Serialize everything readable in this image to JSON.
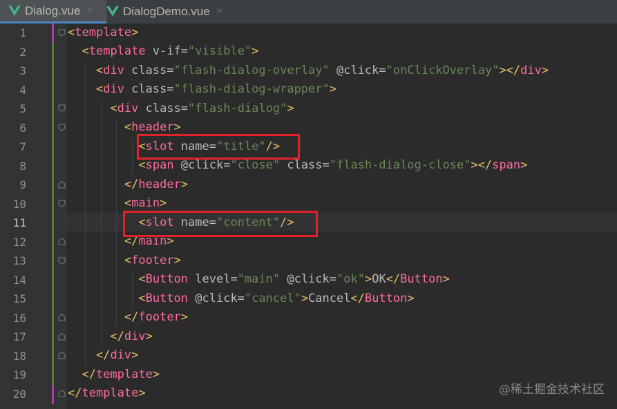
{
  "tabs": [
    {
      "label": "Dialog.vue",
      "close": "×",
      "active": true
    },
    {
      "label": "DialogDemo.vue",
      "close": "×",
      "active": false
    }
  ],
  "line_numbers": [
    "1",
    "2",
    "3",
    "4",
    "5",
    "6",
    "7",
    "8",
    "9",
    "10",
    "11",
    "12",
    "13",
    "14",
    "15",
    "16",
    "17",
    "18",
    "19",
    "20"
  ],
  "current_line": "11",
  "code_lines": [
    {
      "num": "1",
      "text": "<template>"
    },
    {
      "num": "2",
      "text": "  <template v-if=\"visible\">"
    },
    {
      "num": "3",
      "text": "    <div class=\"flash-dialog-overlay\" @click=\"onClickOverlay\"></div>"
    },
    {
      "num": "4",
      "text": "    <div class=\"flash-dialog-wrapper\">"
    },
    {
      "num": "5",
      "text": "      <div class=\"flash-dialog\">"
    },
    {
      "num": "6",
      "text": "        <header>"
    },
    {
      "num": "7",
      "text": "          <slot name=\"title\"/>"
    },
    {
      "num": "8",
      "text": "          <span @click=\"close\" class=\"flash-dialog-close\"></span>"
    },
    {
      "num": "9",
      "text": "        </header>"
    },
    {
      "num": "10",
      "text": "        <main>"
    },
    {
      "num": "11",
      "text": "          <slot name=\"content\"/>"
    },
    {
      "num": "12",
      "text": "        </main>"
    },
    {
      "num": "13",
      "text": "        <footer>"
    },
    {
      "num": "14",
      "text": "          <Button level=\"main\" @click=\"ok\">OK</Button>"
    },
    {
      "num": "15",
      "text": "          <Button @click=\"cancel\">Cancel</Button>"
    },
    {
      "num": "16",
      "text": "        </footer>"
    },
    {
      "num": "17",
      "text": "      </div>"
    },
    {
      "num": "18",
      "text": "    </div>"
    },
    {
      "num": "19",
      "text": "  </template>"
    },
    {
      "num": "20",
      "text": "</template>"
    }
  ],
  "highlights": [
    "<slot name=\"title\"/>",
    "<slot name=\"content\"/>"
  ],
  "watermark": "@稀土掘金技术社区",
  "colors": {
    "background": "#2b2b2b",
    "tag_bracket": "#e8bf6a",
    "tag_name": "#ff6b9d",
    "string": "#6a8759",
    "annotation_box": "#e0222a"
  }
}
